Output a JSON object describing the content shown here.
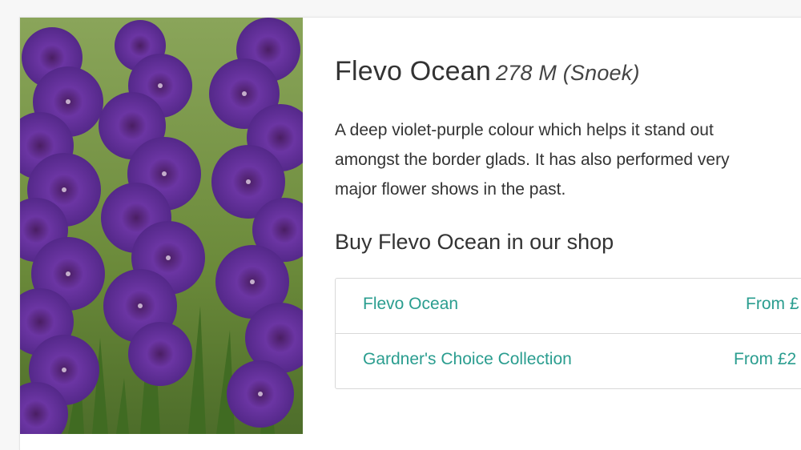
{
  "product": {
    "name": "Flevo Ocean",
    "subtitle": "278 M (Snoek)",
    "image_alt": "Purple gladiolus flowers",
    "description_lines": [
      "A deep violet-purple colour which helps it stand out",
      "amongst the border glads. It has also performed very",
      "major flower shows in the past."
    ]
  },
  "shop": {
    "heading": "Buy Flevo Ocean in our shop",
    "items": [
      {
        "name": "Flevo Ocean",
        "price": "From £"
      },
      {
        "name": "Gardner's Choice Collection",
        "price": "From £2"
      }
    ]
  },
  "colors": {
    "link": "#2a9d8f",
    "flower": "#5b2a8c",
    "foliage": "#6e8f3e"
  }
}
